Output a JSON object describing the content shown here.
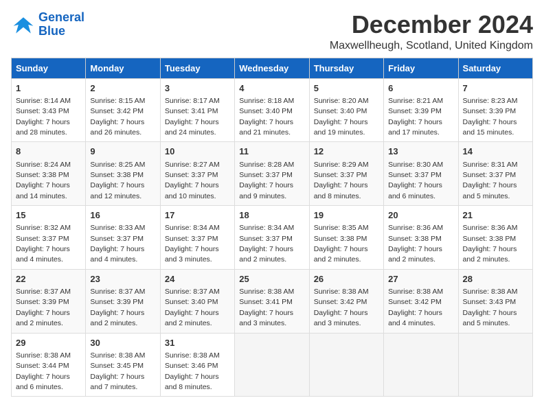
{
  "logo": {
    "line1": "General",
    "line2": "Blue"
  },
  "title": "December 2024",
  "location": "Maxwellheugh, Scotland, United Kingdom",
  "headers": [
    "Sunday",
    "Monday",
    "Tuesday",
    "Wednesday",
    "Thursday",
    "Friday",
    "Saturday"
  ],
  "weeks": [
    [
      {
        "day": "1",
        "sunrise": "8:14 AM",
        "sunset": "3:43 PM",
        "daylight": "7 hours and 28 minutes."
      },
      {
        "day": "2",
        "sunrise": "8:15 AM",
        "sunset": "3:42 PM",
        "daylight": "7 hours and 26 minutes."
      },
      {
        "day": "3",
        "sunrise": "8:17 AM",
        "sunset": "3:41 PM",
        "daylight": "7 hours and 24 minutes."
      },
      {
        "day": "4",
        "sunrise": "8:18 AM",
        "sunset": "3:40 PM",
        "daylight": "7 hours and 21 minutes."
      },
      {
        "day": "5",
        "sunrise": "8:20 AM",
        "sunset": "3:40 PM",
        "daylight": "7 hours and 19 minutes."
      },
      {
        "day": "6",
        "sunrise": "8:21 AM",
        "sunset": "3:39 PM",
        "daylight": "7 hours and 17 minutes."
      },
      {
        "day": "7",
        "sunrise": "8:23 AM",
        "sunset": "3:39 PM",
        "daylight": "7 hours and 15 minutes."
      }
    ],
    [
      {
        "day": "8",
        "sunrise": "8:24 AM",
        "sunset": "3:38 PM",
        "daylight": "7 hours and 14 minutes."
      },
      {
        "day": "9",
        "sunrise": "8:25 AM",
        "sunset": "3:38 PM",
        "daylight": "7 hours and 12 minutes."
      },
      {
        "day": "10",
        "sunrise": "8:27 AM",
        "sunset": "3:37 PM",
        "daylight": "7 hours and 10 minutes."
      },
      {
        "day": "11",
        "sunrise": "8:28 AM",
        "sunset": "3:37 PM",
        "daylight": "7 hours and 9 minutes."
      },
      {
        "day": "12",
        "sunrise": "8:29 AM",
        "sunset": "3:37 PM",
        "daylight": "7 hours and 8 minutes."
      },
      {
        "day": "13",
        "sunrise": "8:30 AM",
        "sunset": "3:37 PM",
        "daylight": "7 hours and 6 minutes."
      },
      {
        "day": "14",
        "sunrise": "8:31 AM",
        "sunset": "3:37 PM",
        "daylight": "7 hours and 5 minutes."
      }
    ],
    [
      {
        "day": "15",
        "sunrise": "8:32 AM",
        "sunset": "3:37 PM",
        "daylight": "7 hours and 4 minutes."
      },
      {
        "day": "16",
        "sunrise": "8:33 AM",
        "sunset": "3:37 PM",
        "daylight": "7 hours and 4 minutes."
      },
      {
        "day": "17",
        "sunrise": "8:34 AM",
        "sunset": "3:37 PM",
        "daylight": "7 hours and 3 minutes."
      },
      {
        "day": "18",
        "sunrise": "8:34 AM",
        "sunset": "3:37 PM",
        "daylight": "7 hours and 2 minutes."
      },
      {
        "day": "19",
        "sunrise": "8:35 AM",
        "sunset": "3:38 PM",
        "daylight": "7 hours and 2 minutes."
      },
      {
        "day": "20",
        "sunrise": "8:36 AM",
        "sunset": "3:38 PM",
        "daylight": "7 hours and 2 minutes."
      },
      {
        "day": "21",
        "sunrise": "8:36 AM",
        "sunset": "3:38 PM",
        "daylight": "7 hours and 2 minutes."
      }
    ],
    [
      {
        "day": "22",
        "sunrise": "8:37 AM",
        "sunset": "3:39 PM",
        "daylight": "7 hours and 2 minutes."
      },
      {
        "day": "23",
        "sunrise": "8:37 AM",
        "sunset": "3:39 PM",
        "daylight": "7 hours and 2 minutes."
      },
      {
        "day": "24",
        "sunrise": "8:37 AM",
        "sunset": "3:40 PM",
        "daylight": "7 hours and 2 minutes."
      },
      {
        "day": "25",
        "sunrise": "8:38 AM",
        "sunset": "3:41 PM",
        "daylight": "7 hours and 3 minutes."
      },
      {
        "day": "26",
        "sunrise": "8:38 AM",
        "sunset": "3:42 PM",
        "daylight": "7 hours and 3 minutes."
      },
      {
        "day": "27",
        "sunrise": "8:38 AM",
        "sunset": "3:42 PM",
        "daylight": "7 hours and 4 minutes."
      },
      {
        "day": "28",
        "sunrise": "8:38 AM",
        "sunset": "3:43 PM",
        "daylight": "7 hours and 5 minutes."
      }
    ],
    [
      {
        "day": "29",
        "sunrise": "8:38 AM",
        "sunset": "3:44 PM",
        "daylight": "7 hours and 6 minutes."
      },
      {
        "day": "30",
        "sunrise": "8:38 AM",
        "sunset": "3:45 PM",
        "daylight": "7 hours and 7 minutes."
      },
      {
        "day": "31",
        "sunrise": "8:38 AM",
        "sunset": "3:46 PM",
        "daylight": "7 hours and 8 minutes."
      },
      null,
      null,
      null,
      null
    ]
  ],
  "labels": {
    "sunrise": "Sunrise:",
    "sunset": "Sunset:",
    "daylight": "Daylight:"
  },
  "colors": {
    "header_bg": "#1565c0"
  }
}
